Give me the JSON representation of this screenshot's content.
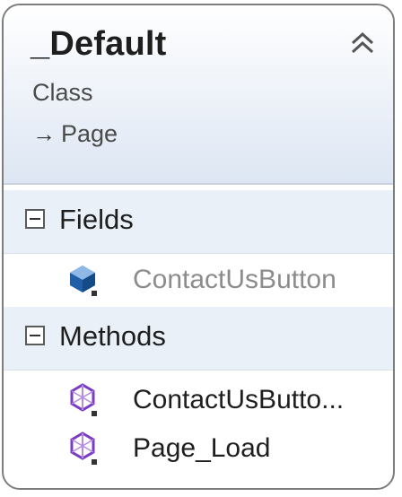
{
  "class_shape": {
    "title": "_Default",
    "kind": "Class",
    "base_class": "Page",
    "base_arrow": "→"
  },
  "sections": {
    "fields": {
      "label": "Fields",
      "items": [
        {
          "name": "ContactUsButton",
          "icon": "field-icon"
        }
      ]
    },
    "methods": {
      "label": "Methods",
      "items": [
        {
          "name": "ContactUsButto...",
          "icon": "method-icon"
        },
        {
          "name": "Page_Load",
          "icon": "method-icon"
        }
      ]
    }
  },
  "colors": {
    "border": "#7d7d7d",
    "header_gradient_end": "#dde6f3",
    "section_bg": "#eaf0f7",
    "field_icon": "#1f5fa8",
    "method_icon": "#7a3cc2",
    "dimmed_text": "#8c8c8c"
  }
}
